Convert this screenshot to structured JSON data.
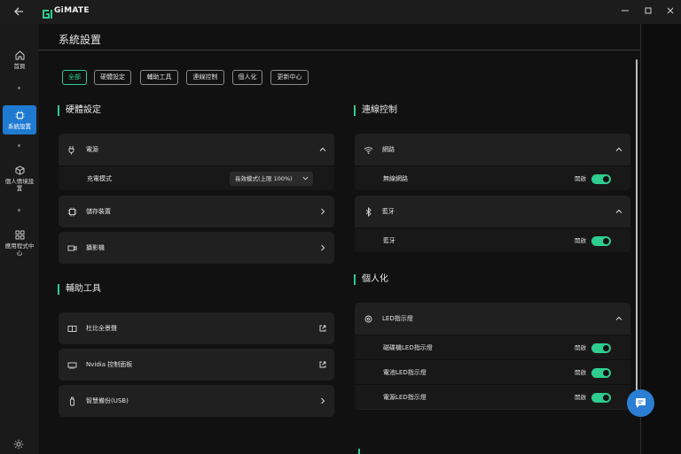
{
  "titlebar": {
    "app_name": "GiMATE"
  },
  "sidebar": {
    "items": [
      {
        "label": "首頁"
      },
      {
        "label": "系統設置"
      },
      {
        "label": "個人情境設置"
      },
      {
        "label": "應用程式中心"
      }
    ]
  },
  "page": {
    "title": "系統設置"
  },
  "tabs": [
    {
      "label": "全部"
    },
    {
      "label": "硬體設定"
    },
    {
      "label": "輔助工具"
    },
    {
      "label": "連線控制"
    },
    {
      "label": "個人化"
    },
    {
      "label": "更新中心"
    }
  ],
  "hardware": {
    "title": "硬體設定",
    "power_label": "電源",
    "charge_mode_label": "充電模式",
    "charge_mode_value": "長效模式(上限 100%)",
    "storage_label": "儲存裝置",
    "camera_label": "攝影機"
  },
  "tools": {
    "title": "輔助工具",
    "dolby_label": "杜比全景聲",
    "nvidia_label": "Nvidia 控制面板",
    "backup_label": "智慧備份(USB)"
  },
  "connection": {
    "title": "連線控制",
    "network_label": "網路",
    "wifi_label": "無線網路",
    "wifi_state": "開啟",
    "bluetooth_label": "藍牙",
    "bluetooth_sub_label": "藍牙",
    "bluetooth_state": "開啟"
  },
  "personal": {
    "title": "個人化",
    "led_label": "LED指示燈",
    "magnetic_led_label": "磁碟機LED指示燈",
    "magnetic_led_state": "開啟",
    "battery_led_label": "電池LED指示燈",
    "battery_led_state": "開啟",
    "power_led_label": "電源LED指示燈",
    "power_led_state": "開啟"
  },
  "colors": {
    "accent": "#2ecc8f",
    "nav_active": "#1f7ad1",
    "card": "#202020"
  }
}
